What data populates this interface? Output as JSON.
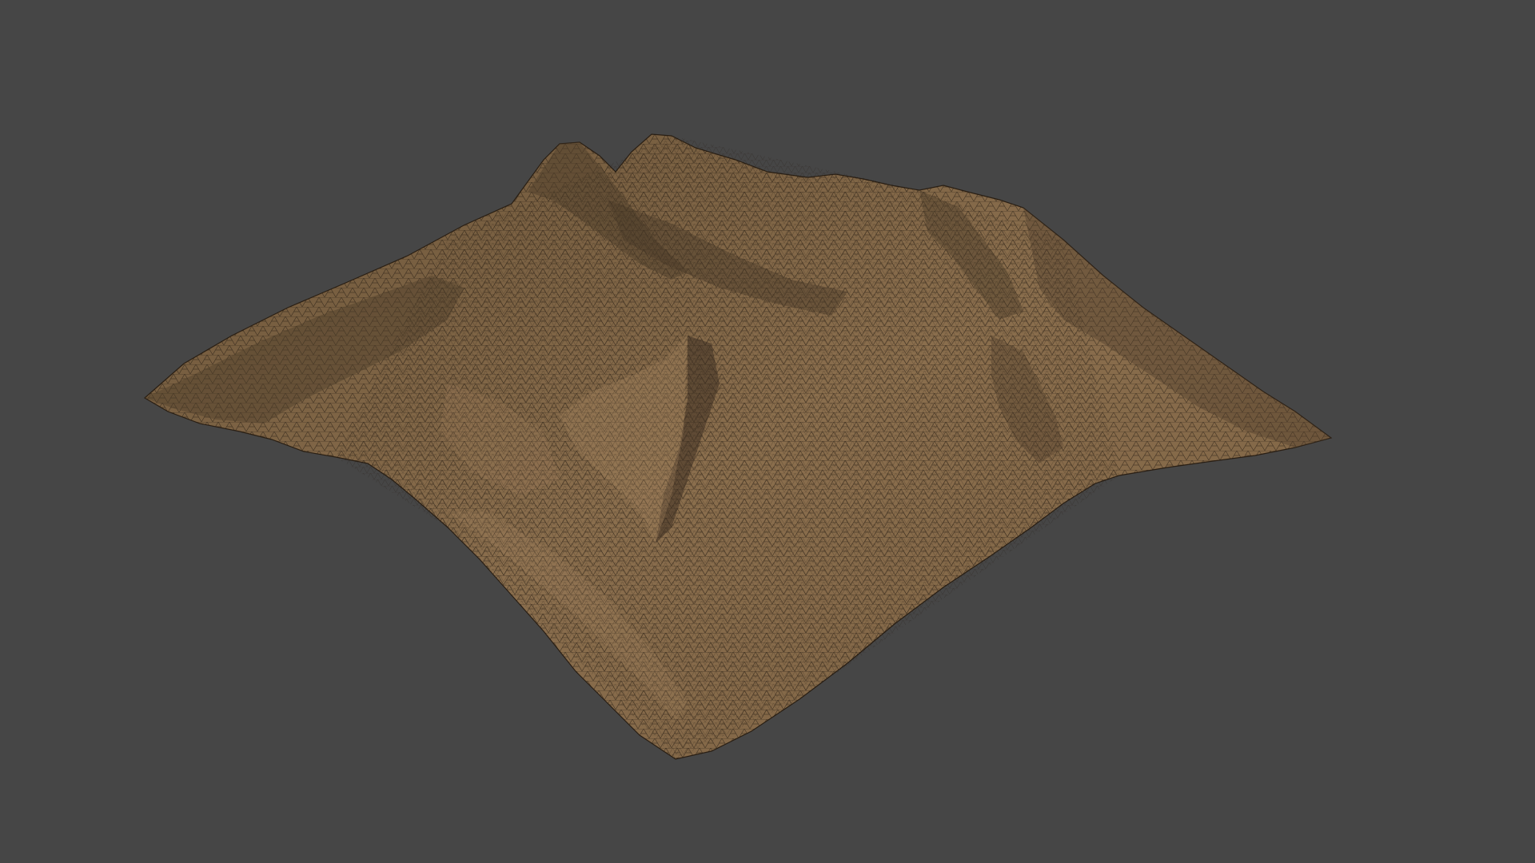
{
  "viewport": {
    "background_color": "#464646"
  },
  "terrain": {
    "description_label": "",
    "base_color": "#8a6e4d",
    "light_color": "#a3845f",
    "dark_color": "#4e3d2a",
    "wire_color": "#1c140c"
  }
}
